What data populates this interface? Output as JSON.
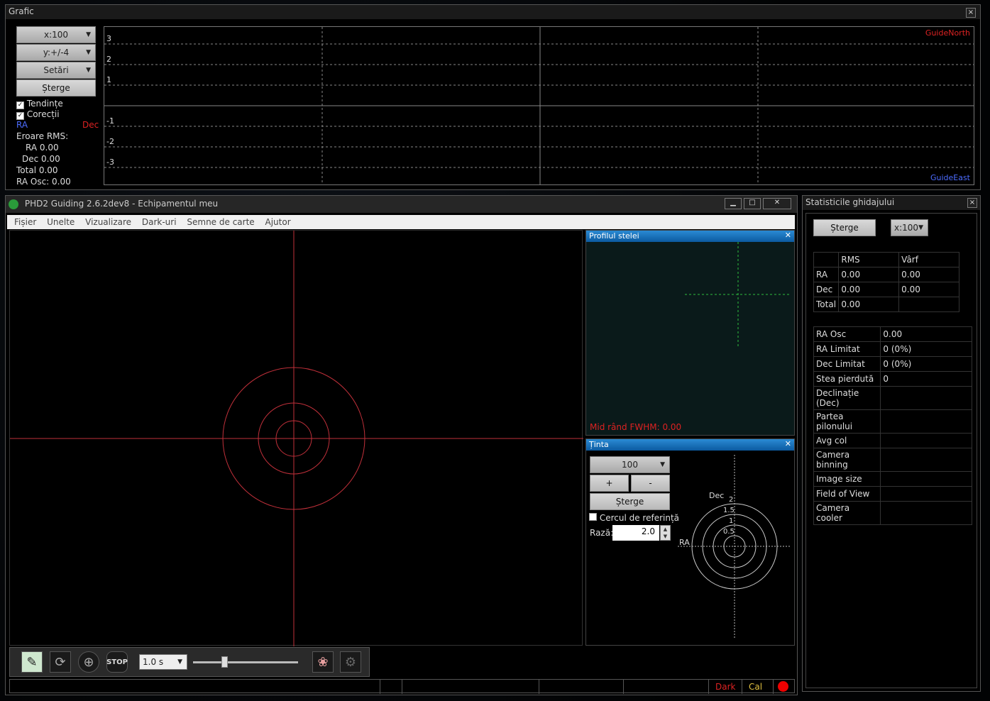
{
  "graph_panel": {
    "title": "Grafic",
    "close": "×",
    "x_scale": "x:100",
    "y_scale": "y:+/-4",
    "settings": "Setări",
    "clear": "Șterge",
    "trends": "Tendințe",
    "corrections": "Corecții",
    "ra_label": "RA",
    "dec_label": "Dec",
    "rms_title": "Eroare RMS:",
    "rms_ra": "RA  0.00",
    "rms_dec": "Dec  0.00",
    "rms_total": "Total  0.00",
    "ra_osc": "RA Osc: 0.00",
    "guide_north": "GuideNorth",
    "guide_east": "GuideEast",
    "y_ticks": [
      "3",
      "2",
      "1",
      "-1",
      "-2",
      "-3"
    ],
    "colors": {
      "ra": "#4444ff",
      "dec": "#dd2222"
    }
  },
  "main_window": {
    "title": "PHD2 Guiding 2.6.2dev8 - Echipamentul meu",
    "min": "▁",
    "max": "□",
    "close": "✕",
    "menu": [
      "Fișier",
      "Unelte",
      "Vizualizare",
      "Dark-uri",
      "Semne de carte",
      "Ajutor"
    ]
  },
  "star_profile": {
    "title": "Profilul stelei",
    "close": "✕",
    "fwhm": "Mid rând FWHM: 0.00"
  },
  "target": {
    "title": "Ținta",
    "close": "✕",
    "scale": "100",
    "plus": "+",
    "minus": "-",
    "clear": "Șterge",
    "ref_circle": "Cercul de referință",
    "radius_label": "Rază:",
    "radius_value": "2.0",
    "dec_label": "Dec",
    "ra_label": "RA",
    "ring_labels": [
      "2",
      "1.5",
      "1",
      "0.5"
    ]
  },
  "toolbar": {
    "exposure": "1.0 s",
    "slider_level": 0.3
  },
  "status_bar": {
    "dark": "Dark",
    "cal": "Cal"
  },
  "stats_panel": {
    "title": "Statisticile ghidajului",
    "close": "×",
    "clear": "Șterge",
    "x_scale": "x:100",
    "rms_headers": [
      "",
      "RMS",
      "Vârf"
    ],
    "rms_rows": [
      [
        "RA",
        "0.00",
        "0.00"
      ],
      [
        "Dec",
        "0.00",
        "0.00"
      ],
      [
        "Total",
        "0.00",
        ""
      ]
    ],
    "info_rows": [
      [
        "RA Osc",
        "0.00"
      ],
      [
        "RA Limitat",
        "0 (0%)"
      ],
      [
        "Dec Limitat",
        "0 (0%)"
      ],
      [
        "Stea pierdută",
        "0"
      ],
      [
        "Declinație (Dec)",
        ""
      ],
      [
        "Partea pilonului",
        ""
      ],
      [
        "Avg col",
        ""
      ],
      [
        "Camera binning",
        ""
      ],
      [
        "Image size",
        ""
      ],
      [
        "Field of View",
        ""
      ],
      [
        "Camera cooler",
        ""
      ]
    ]
  }
}
